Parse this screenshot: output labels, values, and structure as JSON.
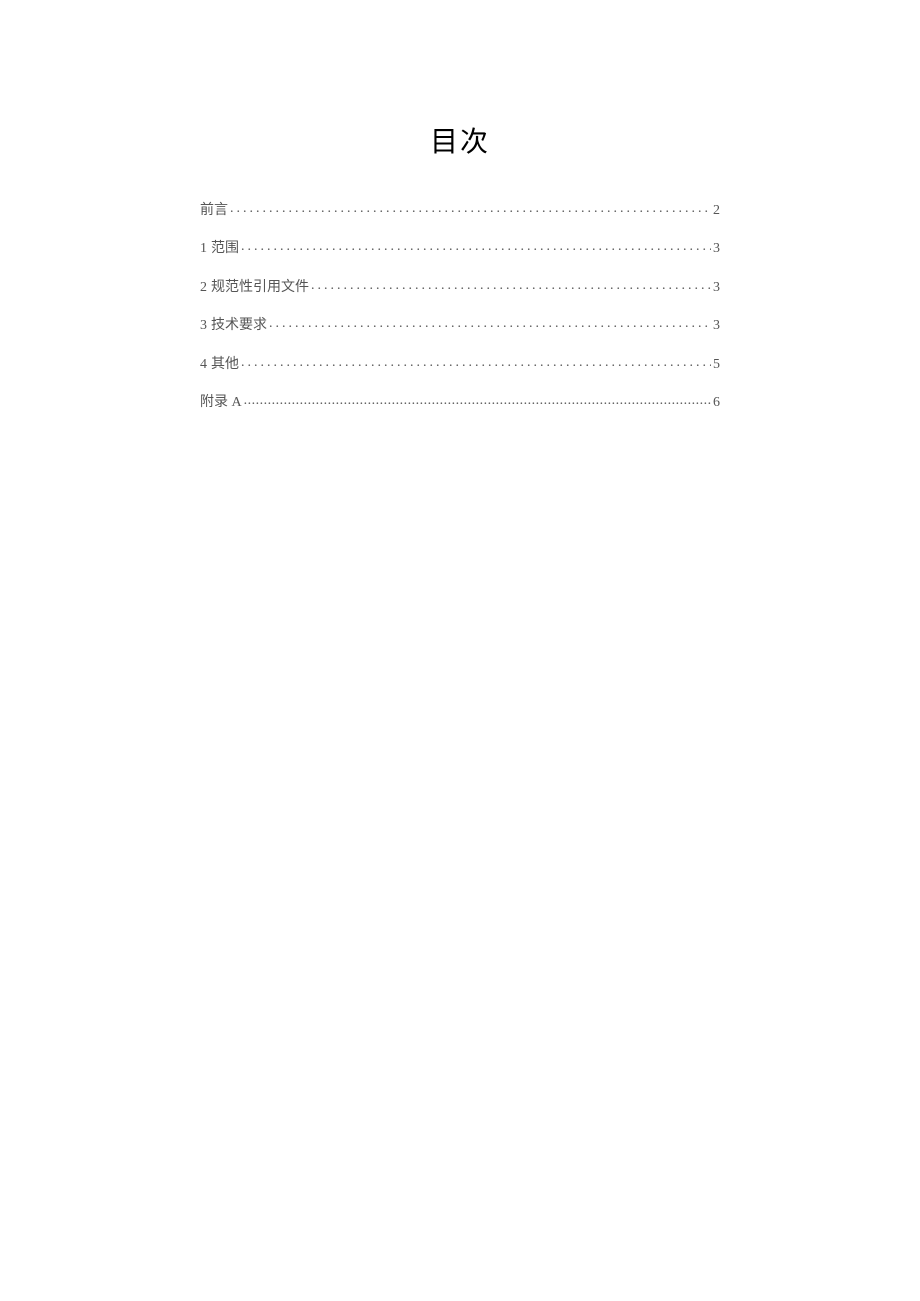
{
  "title": "目次",
  "toc": [
    {
      "num": "",
      "label": "前言",
      "page": "2",
      "tight": false
    },
    {
      "num": "1",
      "label": "范围",
      "page": "3",
      "tight": false
    },
    {
      "num": "2",
      "label": "规范性引用文件",
      "page": "3",
      "tight": false
    },
    {
      "num": "3",
      "label": "技术要求",
      "page": "3",
      "tight": false
    },
    {
      "num": "4",
      "label": "其他",
      "page": "5",
      "tight": false
    },
    {
      "num": "",
      "label": "附录 A",
      "page": "6",
      "tight": true
    }
  ]
}
